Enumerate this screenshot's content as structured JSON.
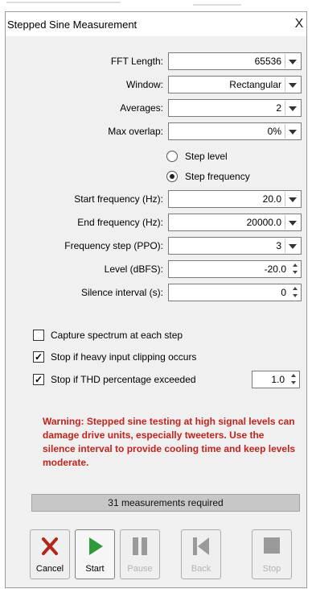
{
  "window": {
    "title": "Stepped Sine Measurement",
    "close_glyph": "X"
  },
  "settings": {
    "fft_length": {
      "label": "FFT Length:",
      "value": "65536"
    },
    "window_fn": {
      "label": "Window:",
      "value": "Rectangular"
    },
    "averages": {
      "label": "Averages:",
      "value": "2"
    },
    "max_overlap": {
      "label": "Max overlap:",
      "value": "0%"
    }
  },
  "mode": {
    "step_level": {
      "label": "Step level",
      "selected": false
    },
    "step_frequency": {
      "label": "Step frequency",
      "selected": true
    }
  },
  "sweep": {
    "start_frequency": {
      "label": "Start frequency (Hz):",
      "value": "20.0"
    },
    "end_frequency": {
      "label": "End frequency (Hz):",
      "value": "20000.0"
    },
    "frequency_step": {
      "label": "Frequency step (PPO):",
      "value": "3"
    },
    "level": {
      "label": "Level (dBFS):",
      "value": "-20.0"
    },
    "silence_interval": {
      "label": "Silence interval (s):",
      "value": "0"
    }
  },
  "options": {
    "capture_spectrum": {
      "label": "Capture spectrum at each step",
      "checked": false
    },
    "stop_clipping": {
      "label": "Stop if heavy input clipping occurs",
      "checked": true
    },
    "stop_thd": {
      "label": "Stop if THD percentage exceeded",
      "checked": true,
      "value": "1.0"
    },
    "check_glyph": "✓"
  },
  "warning": "Warning: Stepped sine testing at high signal levels can damage drive units, especially tweeters. Use the silence interval to provide cooling time and keep levels moderate.",
  "status": "31 measurements required",
  "toolbar": {
    "cancel": {
      "label": "Cancel",
      "icon": "x-icon",
      "enabled": true
    },
    "start": {
      "label": "Start",
      "icon": "play-icon",
      "enabled": true
    },
    "pause": {
      "label": "Pause",
      "icon": "pause-icon",
      "enabled": false
    },
    "back": {
      "label": "Back",
      "icon": "skip-back-icon",
      "enabled": false
    },
    "stop": {
      "label": "Stop",
      "icon": "stop-icon",
      "enabled": false
    }
  },
  "colors": {
    "warning_text": "#c0241c",
    "cancel_icon": "#b3261e",
    "start_icon": "#2e9a3c",
    "disabled_icon": "#9a9a9a",
    "status_bar": "#c7c7c7",
    "dialog_bg": "#f0f0f0"
  }
}
